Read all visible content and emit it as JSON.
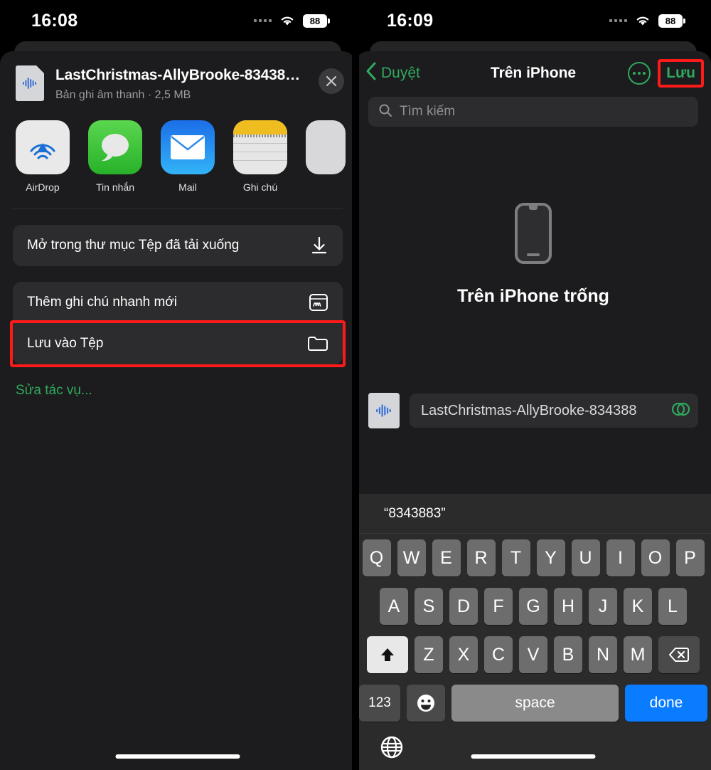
{
  "left": {
    "status": {
      "time": "16:08",
      "battery": "88",
      "wifi_icon": "wifi-icon",
      "signal_icon": "signal-dots-icon"
    },
    "file": {
      "title": "LastChristmas-AllyBrooke-83438…",
      "subtitle": "Bản ghi âm thanh · 2,5 MB",
      "thumb_icon": "audio-waveform-file-icon",
      "close_icon": "close-icon"
    },
    "apps": [
      {
        "label": "AirDrop",
        "icon": "airdrop-icon"
      },
      {
        "label": "Tin nhắn",
        "icon": "messages-icon"
      },
      {
        "label": "Mail",
        "icon": "mail-icon"
      },
      {
        "label": "Ghi chú",
        "icon": "notes-icon"
      }
    ],
    "actions_group_1": [
      {
        "label": "Mở trong thư mục Tệp đã tải xuống",
        "icon": "download-icon",
        "highlighted": false
      }
    ],
    "actions_group_2": [
      {
        "label": "Thêm ghi chú nhanh mới",
        "icon": "quick-note-icon",
        "highlighted": false
      },
      {
        "label": "Lưu vào Tệp",
        "icon": "folder-icon",
        "highlighted": true
      }
    ],
    "edit_actions_label": "Sửa tác vụ..."
  },
  "right": {
    "status": {
      "time": "16:09",
      "battery": "88",
      "wifi_icon": "wifi-icon",
      "signal_icon": "signal-dots-icon"
    },
    "nav": {
      "back_label": "Duyệt",
      "back_icon": "chevron-left-icon",
      "title": "Trên iPhone",
      "more_icon": "more-circle-icon",
      "save_label": "Lưu",
      "save_highlighted": true
    },
    "search": {
      "placeholder": "Tìm kiếm",
      "icon": "search-icon"
    },
    "empty": {
      "icon": "iphone-device-icon",
      "title": "Trên iPhone trống"
    },
    "filename_row": {
      "thumb_icon": "audio-waveform-file-icon",
      "value": "LastChristmas-AllyBrooke-834388",
      "clear_icon": "clear-text-icon"
    },
    "keyboard": {
      "suggestions": [
        "“8343883”",
        "",
        ""
      ],
      "row1": [
        "Q",
        "W",
        "E",
        "R",
        "T",
        "Y",
        "U",
        "I",
        "O",
        "P"
      ],
      "row2": [
        "A",
        "S",
        "D",
        "F",
        "G",
        "H",
        "J",
        "K",
        "L"
      ],
      "row3": [
        "Z",
        "X",
        "C",
        "V",
        "B",
        "N",
        "M"
      ],
      "shift_icon": "shift-up-icon",
      "backspace_icon": "backspace-icon",
      "numbers_label": "123",
      "emoji_icon": "emoji-smiley-icon",
      "space_label": "space",
      "done_label": "done",
      "globe_icon": "globe-icon"
    }
  },
  "colors": {
    "accent_green": "#2fa95d",
    "highlight_red": "#ff1a1a",
    "done_blue": "#0a7cff",
    "sheet_bg": "#1c1c1e",
    "row_bg": "#2c2c2e"
  }
}
